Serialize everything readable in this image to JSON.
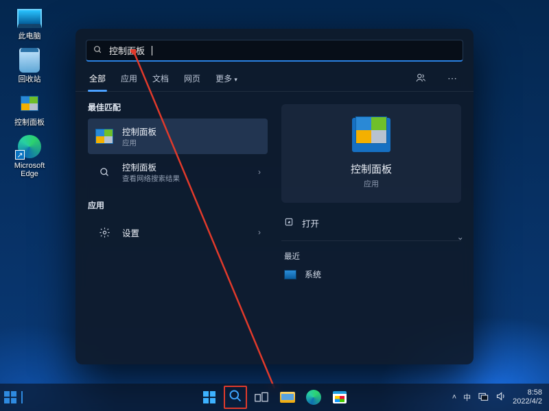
{
  "desktop": {
    "items": [
      {
        "label": "此电脑"
      },
      {
        "label": "回收站"
      },
      {
        "label": "控制面板"
      },
      {
        "label": "Microsoft Edge"
      }
    ]
  },
  "search": {
    "query": "控制面板",
    "tabs": [
      "全部",
      "应用",
      "文档",
      "网页",
      "更多"
    ],
    "active_tab": 0,
    "section_best": "最佳匹配",
    "section_apps": "应用",
    "results": [
      {
        "title": "控制面板",
        "subtitle": "应用"
      },
      {
        "title": "控制面板",
        "subtitle": "查看网络搜索结果"
      },
      {
        "title": "设置",
        "subtitle": ""
      }
    ],
    "preview": {
      "title": "控制面板",
      "subtitle": "应用",
      "open": "打开",
      "recent_label": "最近",
      "recent": [
        "系统"
      ]
    }
  },
  "taskbar": {
    "time": "8:58",
    "date": "2022/4/2",
    "ime": "中"
  }
}
